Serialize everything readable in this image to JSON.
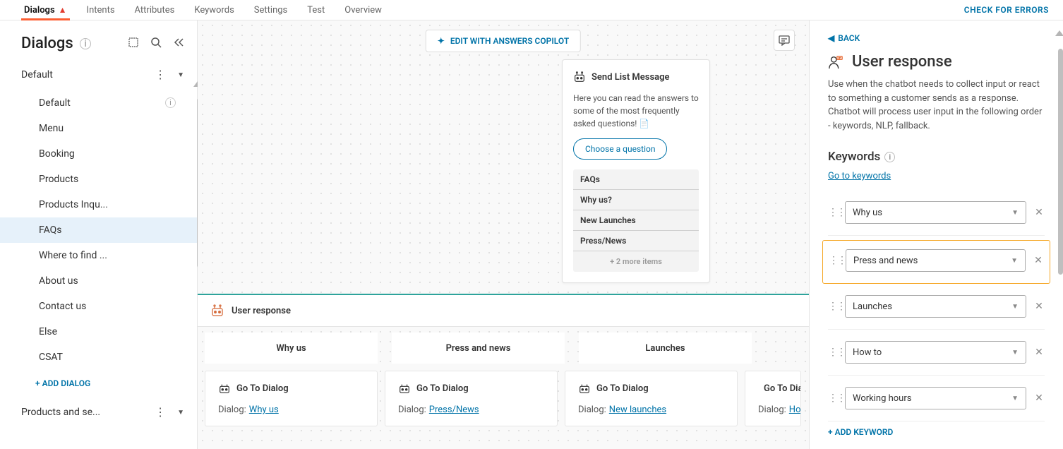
{
  "topnav": {
    "tabs": [
      "Dialogs",
      "Intents",
      "Attributes",
      "Keywords",
      "Settings",
      "Test",
      "Overview"
    ],
    "check_errors": "CHECK FOR ERRORS"
  },
  "sidebar": {
    "title": "Dialogs",
    "group1": "Default",
    "items": [
      "Default",
      "Menu",
      "Booking",
      "Products",
      "Products Inqu...",
      "FAQs",
      "Where to find ...",
      "About us",
      "Contact us",
      "Else",
      "CSAT"
    ],
    "add": "+ ADD DIALOG",
    "group2": "Products and se..."
  },
  "canvas": {
    "copilot": "EDIT WITH ANSWERS COPILOT",
    "card": {
      "title": "Send List Message",
      "text": "Here you can read the answers to some of the most frequently asked questions! 📄",
      "choose": "Choose a question",
      "items": [
        "FAQs",
        "Why us?",
        "New Launches",
        "Press/News"
      ],
      "more": "+ 2 more items"
    },
    "ur_header": "User response",
    "ur_tabs": [
      "Why us",
      "Press and news",
      "Launches"
    ],
    "go_title": "Go To Dialog",
    "go_label": "Dialog:",
    "go_links": [
      "Why us",
      "Press/News",
      "New launches",
      "How"
    ]
  },
  "rightpanel": {
    "back": "BACK",
    "title": "User response",
    "desc": "Use when the chatbot needs to collect input or react to something a customer sends as a response. Chatbot will process user input in the following order - keywords, NLP, fallback.",
    "subhead": "Keywords",
    "link": "Go to keywords",
    "keywords": [
      "Why us",
      "Press and news",
      "Launches",
      "How to",
      "Working hours"
    ],
    "add": "+ ADD KEYWORD"
  }
}
